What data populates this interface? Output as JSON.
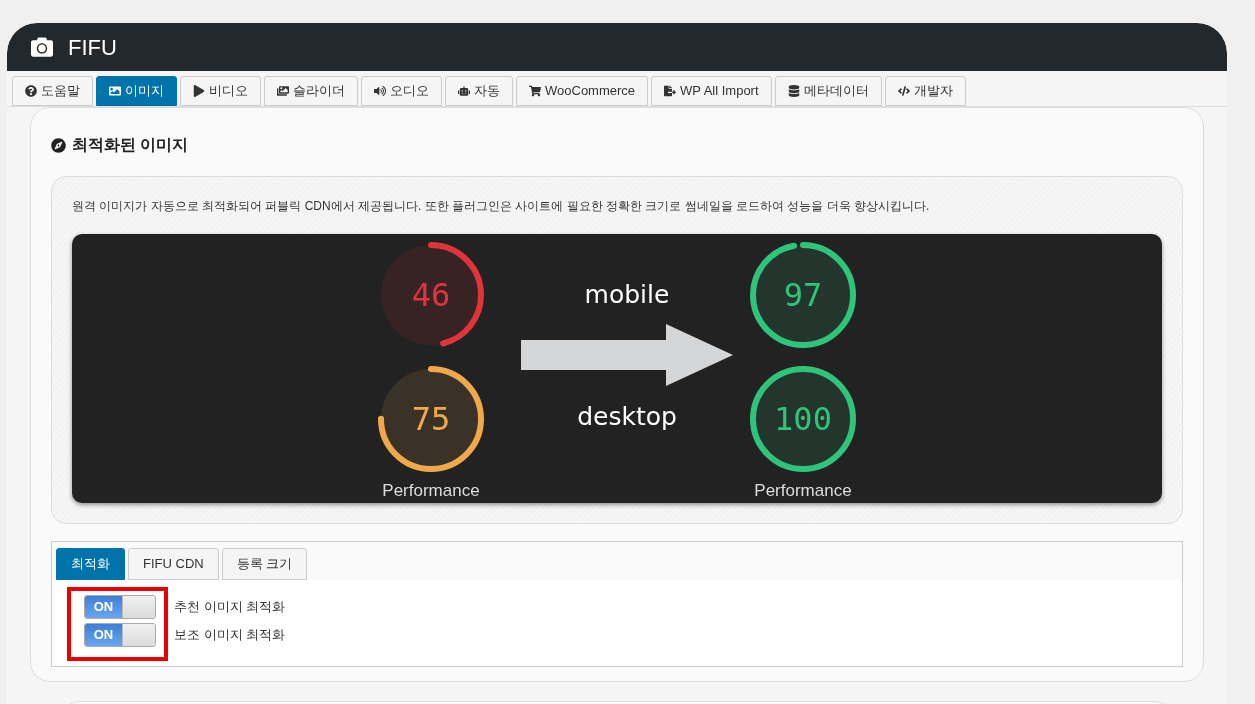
{
  "header": {
    "title": "FIFU"
  },
  "tabs": [
    {
      "label": "도움말",
      "selected": false
    },
    {
      "label": "이미지",
      "selected": true
    },
    {
      "label": "비디오",
      "selected": false
    },
    {
      "label": "슬라이더",
      "selected": false
    },
    {
      "label": "오디오",
      "selected": false
    },
    {
      "label": "자동",
      "selected": false
    },
    {
      "label": "WooCommerce",
      "selected": false
    },
    {
      "label": "WP All Import",
      "selected": false
    },
    {
      "label": "메타데이터",
      "selected": false
    },
    {
      "label": "개발자",
      "selected": false
    }
  ],
  "section": {
    "title": "최적화된 이미지",
    "description": "원격 이미지가 자동으로 최적화되어 퍼블릭 CDN에서 제공됩니다. 또한 플러그인은 사이트에 필요한 정확한 크기로 썸네일을 로드하여 성능을 더욱 향상시킵니다.",
    "comparison": {
      "before": [
        {
          "score": "46",
          "color": "#e0343c"
        },
        {
          "score": "75",
          "color": "#f0a94a"
        }
      ],
      "after": [
        {
          "score": "97",
          "color": "#2fc47a"
        },
        {
          "score": "100",
          "color": "#2fc47a"
        }
      ],
      "before_caption": "Performance",
      "after_caption": "Performance",
      "labels": [
        "mobile",
        "desktop"
      ]
    }
  },
  "subtabs": [
    {
      "label": "최적화",
      "selected": true
    },
    {
      "label": "FIFU CDN",
      "selected": false
    },
    {
      "label": "등록 크기",
      "selected": false
    }
  ],
  "toggles": [
    {
      "state_label": "ON",
      "on": true,
      "label": "추천 이미지 최적화"
    },
    {
      "state_label": "ON",
      "on": true,
      "label": "보조 이미지 최적화"
    }
  ]
}
